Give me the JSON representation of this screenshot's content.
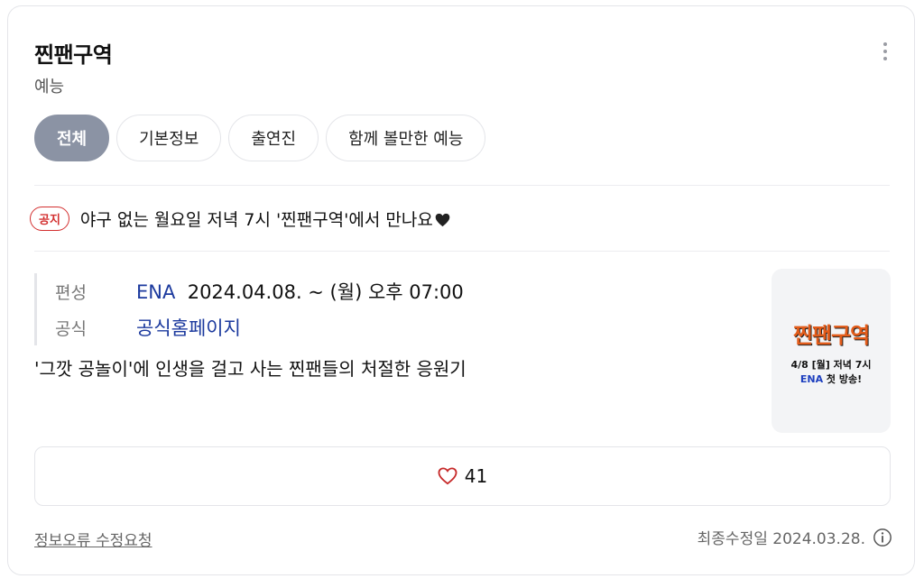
{
  "header": {
    "title": "찐팬구역",
    "category": "예능"
  },
  "tabs": [
    {
      "label": "전체",
      "active": true
    },
    {
      "label": "기본정보",
      "active": false
    },
    {
      "label": "출연진",
      "active": false
    },
    {
      "label": "함께 볼만한 예능",
      "active": false
    }
  ],
  "notice": {
    "badge": "공지",
    "text": "야구 없는 월요일 저녁 7시 '찐팬구역'에서 만나요"
  },
  "info": {
    "broadcast_label": "편성",
    "channel": "ENA",
    "schedule": "2024.04.08. ~  (월) 오후 07:00",
    "official_label": "공식",
    "official_link": "공식홈페이지"
  },
  "synopsis": "'그깟 공놀이'에 인생을 걸고 사는 찐팬들의 처절한 응원기",
  "poster": {
    "title": "찐팬구역",
    "line1": "4/8 [월] 저녁 7시",
    "line2_channel": "ENA",
    "line2_text": " 첫 방송!"
  },
  "likes": {
    "count": "41"
  },
  "footer": {
    "report_link": "정보오류 수정요청",
    "last_updated": "최종수정일 2024.03.28."
  },
  "colors": {
    "active_tab": "#8b93a4",
    "notice_red": "#d32f2f",
    "link_blue": "#1c3a9e",
    "heart": "#c62828"
  }
}
